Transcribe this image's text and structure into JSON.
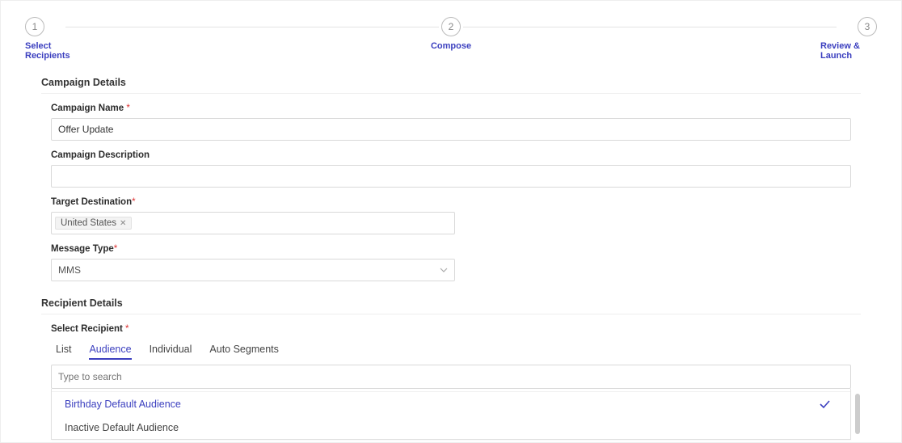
{
  "stepper": {
    "steps": [
      {
        "num": "1",
        "label": "Select Recipients"
      },
      {
        "num": "2",
        "label": "Compose"
      },
      {
        "num": "3",
        "label": "Review & Launch"
      }
    ]
  },
  "campaign": {
    "section_title": "Campaign Details",
    "name_label": "Campaign Name",
    "name_value": "Offer Update",
    "desc_label": "Campaign Description",
    "desc_value": "",
    "target_label": "Target Destination",
    "target_tag": "United States",
    "msg_label": "Message Type",
    "msg_value": "MMS"
  },
  "recipient": {
    "section_title": "Recipient Details",
    "select_label": "Select Recipient",
    "tabs": {
      "list": "List",
      "audience": "Audience",
      "individual": "Individual",
      "auto": "Auto Segments"
    },
    "search_placeholder": "Type to search",
    "options": {
      "o1": "Birthday Default Audience",
      "o2": "Inactive Default Audience"
    }
  }
}
